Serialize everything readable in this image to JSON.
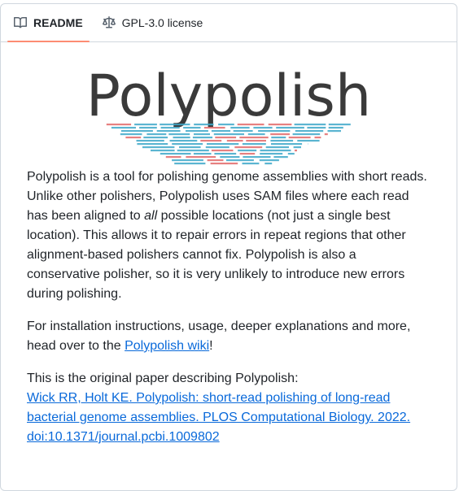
{
  "tabs": [
    {
      "label": "README",
      "icon": "book-icon",
      "active": true
    },
    {
      "label": "GPL-3.0 license",
      "icon": "scale-icon",
      "active": false
    }
  ],
  "logo": {
    "title": "Polypolish"
  },
  "paragraph1": {
    "part1": "Polypolish is a tool for polishing genome assemblies with short reads. Unlike other polishers, Polypolish uses SAM files where each read has been aligned to ",
    "em": "all",
    "part2": " possible locations (not just a single best location). This allows it to repair errors in repeat regions that other alignment-based polishers cannot fix. Polypolish is also a conservative polisher, so it is very unlikely to introduce new errors during polishing."
  },
  "paragraph2": {
    "text": "For installation instructions, usage, deeper explanations and more, head over to the ",
    "link": "Polypolish wiki",
    "suffix": "!"
  },
  "paragraph3": {
    "intro": "This is the original paper describing Polypolish:",
    "citation": "Wick RR, Holt KE. Polypolish: short-read polishing of long-read bacterial genome assemblies. PLOS Computational Biology. 2022. doi:10.1371/journal.pcbi.1009802"
  },
  "colors": {
    "accent": "#fd8c73",
    "link": "#0969da",
    "logo_blue": "#3ea8c9",
    "logo_red": "#e26a6a"
  }
}
